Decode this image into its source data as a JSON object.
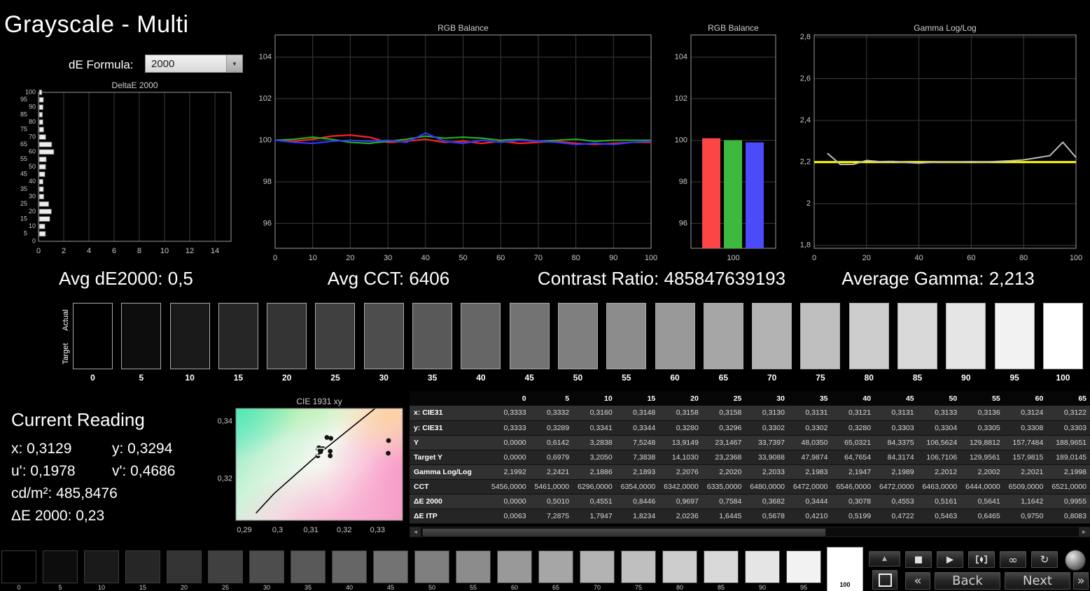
{
  "title": "Grayscale - Multi",
  "de_formula": {
    "label": "dE Formula:",
    "value": "2000",
    "dropdown_icon": "▼"
  },
  "stats": {
    "avg_de": "Avg dE2000: 0,5",
    "avg_cct": "Avg CCT: 6406",
    "contrast": "Contrast Ratio: 485847639193",
    "avg_gamma": "Average Gamma: 2,213"
  },
  "swatch_strip": {
    "row_labels": [
      "Actual",
      "Target"
    ],
    "levels": [
      0,
      5,
      10,
      15,
      20,
      25,
      30,
      35,
      40,
      45,
      50,
      55,
      60,
      65,
      70,
      75,
      80,
      85,
      90,
      95,
      100
    ]
  },
  "current_reading": {
    "title": "Current Reading",
    "lines": [
      {
        "a": "x: 0,3129",
        "b": "y: 0,3294"
      },
      {
        "a": "u': 0,1978",
        "b": "v': 0,4686"
      },
      {
        "a": "cd/m²: 485,8476",
        "b": ""
      },
      {
        "a": "ΔE 2000: 0,23",
        "b": ""
      }
    ]
  },
  "table": {
    "columns": [
      "0",
      "5",
      "10",
      "15",
      "20",
      "25",
      "30",
      "35",
      "40",
      "45",
      "50",
      "55",
      "60",
      "65"
    ],
    "rows": [
      {
        "label": "x: CIE31",
        "values": [
          "0,3333",
          "0,3332",
          "0,3160",
          "0,3148",
          "0,3158",
          "0,3158",
          "0,3130",
          "0,3131",
          "0,3121",
          "0,3131",
          "0,3133",
          "0,3136",
          "0,3124",
          "0,3122"
        ]
      },
      {
        "label": "y: CIE31",
        "values": [
          "0,3333",
          "0,3289",
          "0,3341",
          "0,3344",
          "0,3280",
          "0,3296",
          "0,3302",
          "0,3302",
          "0,3280",
          "0,3303",
          "0,3304",
          "0,3305",
          "0,3308",
          "0,3303"
        ]
      },
      {
        "label": "Y",
        "values": [
          "0,0000",
          "0,6142",
          "3,2838",
          "7,5248",
          "13,9149",
          "23,1467",
          "33,7397",
          "48,0350",
          "65,0321",
          "84,3375",
          "106,5624",
          "129,8812",
          "157,7484",
          "188,9651"
        ]
      },
      {
        "label": "Target Y",
        "values": [
          "0,0000",
          "0,6979",
          "3,2050",
          "7,3838",
          "14,1030",
          "23,2368",
          "33,9088",
          "47,9874",
          "64,7654",
          "84,3174",
          "106,7106",
          "129,9561",
          "157,9815",
          "189,0145"
        ]
      },
      {
        "label": "Gamma Log/Log",
        "values": [
          "2,1992",
          "2,2421",
          "2,1886",
          "2,1893",
          "2,2076",
          "2,2020",
          "2,2033",
          "2,1983",
          "2,1947",
          "2,1989",
          "2,2012",
          "2,2002",
          "2,2021",
          "2,1998"
        ]
      },
      {
        "label": "CCT",
        "values": [
          "5456,0000",
          "5461,0000",
          "6296,0000",
          "6354,0000",
          "6342,0000",
          "6335,0000",
          "6480,0000",
          "6472,0000",
          "6546,0000",
          "6472,0000",
          "6463,0000",
          "6444,0000",
          "6509,0000",
          "6521,0000"
        ]
      },
      {
        "label": "ΔE 2000",
        "values": [
          "0,0000",
          "0,5010",
          "0,4551",
          "0,8446",
          "0,9697",
          "0,7584",
          "0,3682",
          "0,3444",
          "0,3078",
          "0,4553",
          "0,5161",
          "0,5641",
          "1,1642",
          "0,9955"
        ]
      },
      {
        "label": "ΔE ITP",
        "values": [
          "0,0063",
          "7,2875",
          "1,7947",
          "1,8234",
          "2,0236",
          "1,6445",
          "0,5678",
          "0,4210",
          "0,5199",
          "0,4722",
          "0,5463",
          "0,6465",
          "0,9750",
          "0,8083"
        ]
      }
    ],
    "scrollbar": {
      "left_icon": "◄",
      "right_icon": "►"
    }
  },
  "patch_bar": {
    "levels": [
      0,
      5,
      10,
      15,
      20,
      25,
      30,
      35,
      40,
      45,
      50,
      55,
      60,
      65,
      70,
      75,
      80,
      85,
      90,
      95,
      100
    ],
    "selected": 100
  },
  "playback": {
    "scroll_up_icon": "▲",
    "stop_icon": "■",
    "play_icon": "▶",
    "continuous_icon": "∞",
    "refresh_icon": "↻",
    "prev_icon": "«",
    "back_label": "Back",
    "next_label": "Next",
    "next_icon": "»"
  },
  "chart_data": [
    {
      "type": "bar",
      "orientation": "horizontal",
      "title": "DeltaE 2000",
      "categories": [
        0,
        5,
        10,
        15,
        20,
        25,
        30,
        35,
        40,
        45,
        50,
        55,
        60,
        65,
        70,
        75,
        80,
        85,
        90,
        95,
        100
      ],
      "values": [
        0.0,
        0.501,
        0.4551,
        0.8446,
        0.9697,
        0.7584,
        0.3682,
        0.3444,
        0.3078,
        0.4553,
        0.5161,
        0.5641,
        1.1642,
        0.9955,
        0.52,
        0.36,
        0.3,
        0.26,
        0.31,
        0.34,
        0.21
      ],
      "xlim": [
        0,
        14
      ],
      "x_ticks": [
        0,
        2,
        4,
        6,
        8,
        10,
        12,
        14
      ]
    },
    {
      "type": "line",
      "title": "RGB Balance",
      "x": [
        0,
        5,
        10,
        15,
        20,
        25,
        30,
        35,
        40,
        45,
        50,
        55,
        60,
        65,
        70,
        75,
        80,
        85,
        90,
        95,
        100
      ],
      "series": [
        {
          "name": "Red",
          "color": "#ff2222",
          "values": [
            100.0,
            99.95,
            100.05,
            100.2,
            100.25,
            100.15,
            99.9,
            99.95,
            100.05,
            99.9,
            99.95,
            99.85,
            99.95,
            99.85,
            99.9,
            99.95,
            99.85,
            99.8,
            99.85,
            99.9,
            99.9
          ]
        },
        {
          "name": "Green",
          "color": "#24ac24",
          "values": [
            100.0,
            100.05,
            100.15,
            100.05,
            99.9,
            99.85,
            99.95,
            100.05,
            100.2,
            100.1,
            100.15,
            100.1,
            100.0,
            100.05,
            99.95,
            100.0,
            100.05,
            99.95,
            100.0,
            100.0,
            100.0
          ]
        },
        {
          "name": "Blue",
          "color": "#3333ff",
          "values": [
            100.0,
            99.9,
            99.85,
            99.95,
            100.0,
            99.95,
            100.0,
            99.9,
            100.35,
            99.95,
            99.85,
            100.0,
            99.9,
            100.0,
            99.95,
            99.9,
            99.8,
            99.85,
            99.8,
            99.9,
            99.95
          ]
        }
      ],
      "ylim": [
        94.8,
        105.07
      ],
      "y_ticks": [
        104,
        102,
        100,
        98,
        96
      ],
      "x_ticks": [
        0,
        10,
        20,
        30,
        40,
        50,
        60,
        70,
        80,
        90,
        100
      ]
    },
    {
      "type": "bar",
      "title": "RGB Balance",
      "categories": [
        "Red",
        "Green",
        "Blue"
      ],
      "values": [
        100.1,
        100.0,
        99.9
      ],
      "colors": [
        "#fb4545",
        "#3dba3d",
        "#4b4bfb"
      ],
      "x_label": "100",
      "ylim": [
        94.8,
        105.07
      ],
      "y_ticks": [
        104,
        102,
        100,
        98,
        96
      ]
    },
    {
      "type": "line",
      "title": "Gamma Log/Log",
      "x": [
        5,
        10,
        15,
        20,
        25,
        30,
        35,
        40,
        45,
        50,
        55,
        60,
        65,
        70,
        75,
        80,
        85,
        90,
        95,
        100
      ],
      "series": [
        {
          "name": "Measured",
          "color": "#bdbdbd",
          "values": [
            2.2421,
            2.1886,
            2.1893,
            2.2076,
            2.202,
            2.2033,
            2.1983,
            2.1947,
            2.1989,
            2.2012,
            2.2002,
            2.2021,
            2.1998,
            2.2031,
            2.206,
            2.2105,
            2.2204,
            2.2306,
            2.2951,
            2.2219
          ]
        }
      ],
      "target": 2.2,
      "target_color": "#ffff00",
      "ylim": [
        1.786,
        2.81
      ],
      "y_ticks": [
        2.8,
        2.6,
        2.4,
        2.2,
        2.0,
        1.8
      ],
      "y_tick_labels": [
        "2,8",
        "2,6",
        "2,4",
        "2,2",
        "2",
        "1,8"
      ],
      "x_ticks": [
        0,
        20,
        40,
        60,
        80,
        100
      ]
    },
    {
      "type": "scatter",
      "title": "CIE 1931 xy",
      "xlim": [
        0.2875,
        0.3375
      ],
      "ylim": [
        0.3055,
        0.3445
      ],
      "x_tick_values": [
        0.29,
        0.3,
        0.31,
        0.32,
        0.33
      ],
      "x_ticks": [
        "0,29",
        "0,3",
        "0,31",
        "0,32",
        "0,33"
      ],
      "y_tick_values": [
        0.34,
        0.32
      ],
      "y_ticks": [
        "0,34",
        "0,32"
      ],
      "points": [
        [
          0.3333,
          0.3333
        ],
        [
          0.3332,
          0.3289
        ],
        [
          0.316,
          0.3341
        ],
        [
          0.3148,
          0.3344
        ],
        [
          0.3158,
          0.328
        ],
        [
          0.3158,
          0.3296
        ],
        [
          0.313,
          0.3302
        ],
        [
          0.3131,
          0.3302
        ],
        [
          0.3121,
          0.328
        ],
        [
          0.3131,
          0.3303
        ],
        [
          0.3133,
          0.3304
        ],
        [
          0.3136,
          0.3305
        ],
        [
          0.3124,
          0.3308
        ],
        [
          0.3122,
          0.3303
        ],
        [
          0.3129,
          0.3294
        ]
      ],
      "target": [
        0.3129,
        0.3294
      ],
      "locus": [
        [
          0.2935,
          0.308
        ],
        [
          0.299,
          0.3149
        ],
        [
          0.3127,
          0.329
        ],
        [
          0.325,
          0.3405
        ],
        [
          0.333,
          0.348
        ]
      ]
    }
  ]
}
